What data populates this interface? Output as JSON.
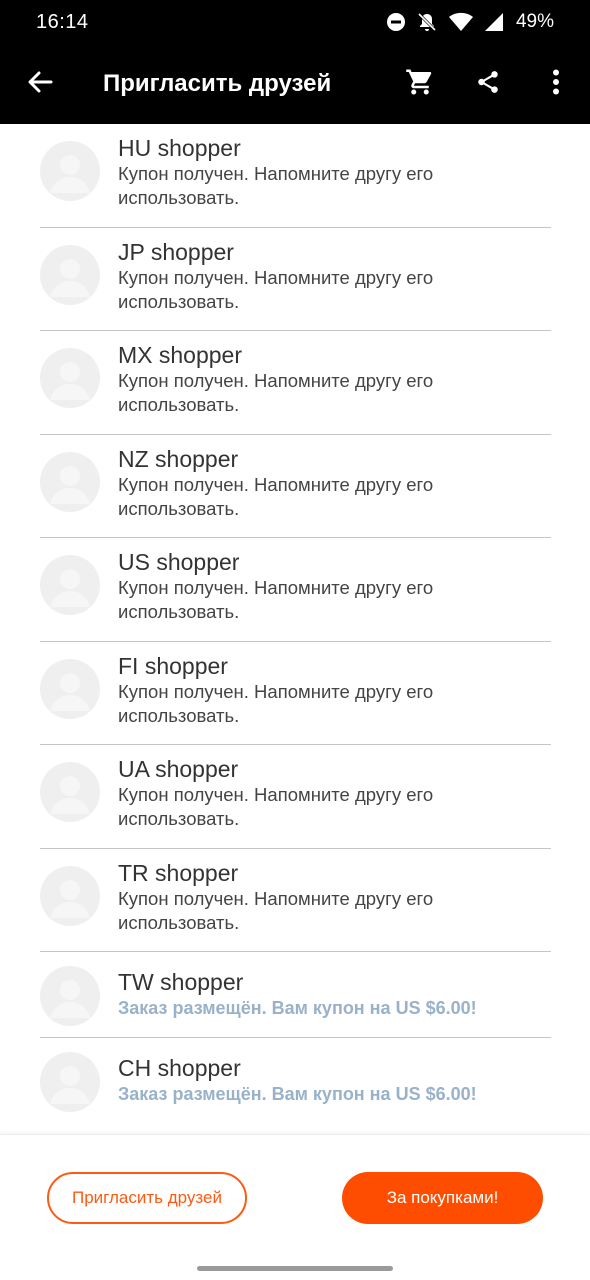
{
  "status_bar": {
    "time": "16:14",
    "battery_percent": "49%",
    "icons": [
      "do-not-disturb-icon",
      "notifications-off-icon",
      "wifi-icon",
      "signal-icon"
    ]
  },
  "app_bar": {
    "title": "Пригласить друзей",
    "icons": [
      "back-arrow-icon",
      "cart-icon",
      "share-icon",
      "more-vert-icon"
    ]
  },
  "friends": [
    {
      "name": "HU shopper",
      "status": "Купон получен. Напомните другу его использовать.",
      "type": "reminder"
    },
    {
      "name": "JP shopper",
      "status": "Купон получен. Напомните другу его использовать.",
      "type": "reminder"
    },
    {
      "name": "MX shopper",
      "status": "Купон получен. Напомните другу его использовать.",
      "type": "reminder"
    },
    {
      "name": "NZ shopper",
      "status": "Купон получен. Напомните другу его использовать.",
      "type": "reminder"
    },
    {
      "name": "US shopper",
      "status": "Купон получен. Напомните другу его использовать.",
      "type": "reminder"
    },
    {
      "name": "FI shopper",
      "status": "Купон получен. Напомните другу его использовать.",
      "type": "reminder"
    },
    {
      "name": "UA shopper",
      "status": "Купон получен. Напомните другу его использовать.",
      "type": "reminder"
    },
    {
      "name": "TR shopper",
      "status": "Купон получен. Напомните другу его использовать.",
      "type": "reminder"
    },
    {
      "name": "TW shopper",
      "status": "Заказ размещён. Вам купон на US $6.00!",
      "type": "reward"
    },
    {
      "name": "CH shopper",
      "status": "Заказ размещён. Вам купон на US $6.00!",
      "type": "reward"
    }
  ],
  "footer": {
    "invite_button": "Пригласить друзей",
    "shop_button": "За покупками!"
  },
  "colors": {
    "accent": "#ff4d00",
    "reward_text": "#99b2c9",
    "header_bg": "#000000"
  }
}
